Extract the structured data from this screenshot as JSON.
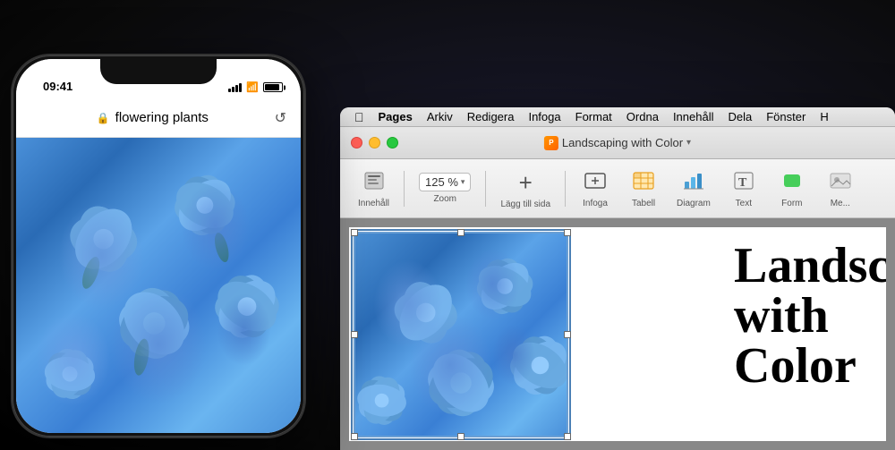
{
  "background": "#000000",
  "iphone": {
    "time": "09:41",
    "address_bar": {
      "url": "flowering plants",
      "lock_icon": "🔒",
      "reload_icon": "↺"
    }
  },
  "mac_window": {
    "title": "Landscaping with Color",
    "traffic_lights": {
      "close": "close",
      "minimize": "minimize",
      "maximize": "maximize"
    }
  },
  "menu_bar": {
    "apple": "⌘",
    "items": [
      {
        "label": "Pages",
        "bold": true
      },
      {
        "label": "Arkiv"
      },
      {
        "label": "Redigera"
      },
      {
        "label": "Infoga"
      },
      {
        "label": "Format"
      },
      {
        "label": "Ordna"
      },
      {
        "label": "Innehåll"
      },
      {
        "label": "Dela"
      },
      {
        "label": "Fönster"
      },
      {
        "label": "H"
      }
    ]
  },
  "toolbar": {
    "innehall_label": "Innehåll",
    "zoom_value": "125 %",
    "zoom_label": "Zoom",
    "add_label": "Lägg till sida",
    "infoga_label": "Infoga",
    "tabell_label": "Tabell",
    "diagram_label": "Diagram",
    "text_label": "Text",
    "form_label": "Form",
    "media_label": "Me..."
  },
  "document": {
    "title_line1": "Landscapi",
    "title_line2": "with Color"
  }
}
